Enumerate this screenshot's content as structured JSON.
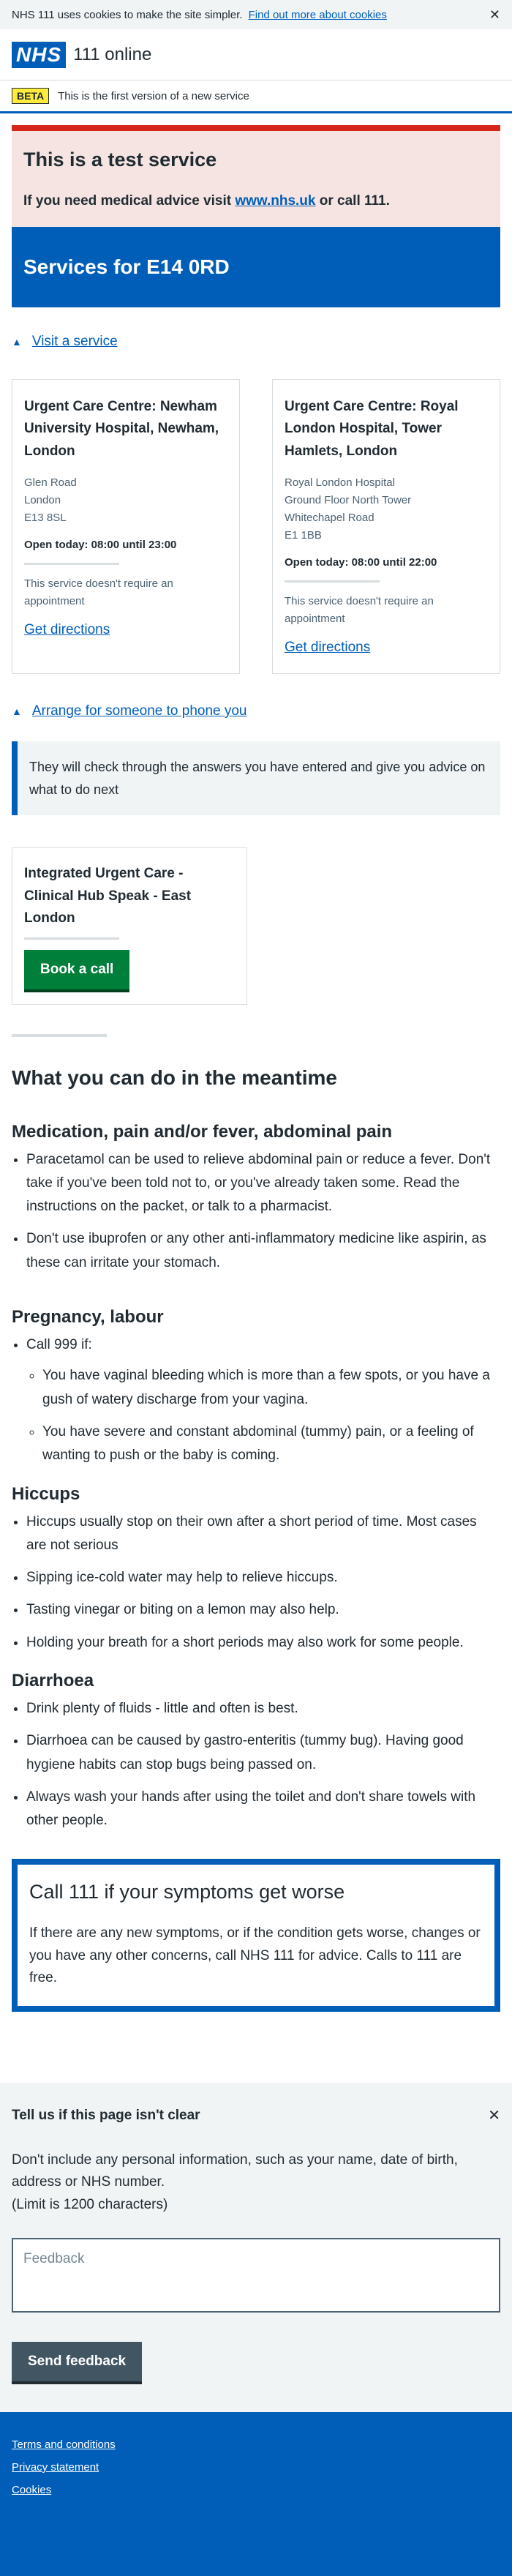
{
  "cookie": {
    "text": "NHS 111 uses cookies to make the site simpler.",
    "link": "Find out more about cookies",
    "close": "✕"
  },
  "header": {
    "logo": "NHS",
    "service": "111 online"
  },
  "beta": {
    "tag": "BETA",
    "text": "This is the first version of a new service"
  },
  "test_service": {
    "title": "This is a test service",
    "text_before": "If you need medical advice visit",
    "link": "www.nhs.uk",
    "text_after": "or call 111."
  },
  "services": {
    "title": "Services for E14 0RD"
  },
  "visit": {
    "label": "Visit a service",
    "cards": [
      {
        "name": "Urgent Care Centre: Newham University Hospital, Newham, London",
        "address": [
          "Glen Road",
          "London",
          "E13 8SL"
        ],
        "open": "Open today: 08:00 until 23:00",
        "appt": "This service doesn't require an appointment",
        "directions": "Get directions"
      },
      {
        "name": "Urgent Care Centre: Royal London Hospital, Tower Hamlets, London",
        "address": [
          "Royal London Hospital",
          "Ground Floor North Tower",
          "Whitechapel Road",
          "E1 1BB"
        ],
        "open": "Open today: 08:00 until 22:00",
        "appt": "This service doesn't require an appointment",
        "directions": "Get directions"
      }
    ]
  },
  "phone": {
    "label": "Arrange for someone to phone you",
    "inset": "They will check through the answers you have entered and give you advice on what to do next",
    "card_title": "Integrated Urgent Care - Clinical Hub Speak - East London",
    "button": "Book a call"
  },
  "meantime": {
    "title": "What you can do in the meantime",
    "sections": [
      {
        "heading": "Medication, pain and/or fever, abdominal pain",
        "items": [
          "Paracetamol can be used to relieve abdominal pain or reduce a fever. Don't take if you've been told not to, or you've already taken some. Read the instructions on the packet, or talk to a pharmacist.",
          "Don't use ibuprofen or any other anti-inflammatory medicine like aspirin, as these can irritate your stomach."
        ]
      },
      {
        "heading": "Pregnancy, labour",
        "lead": "Call 999 if:",
        "subitems": [
          "You have vaginal bleeding which is more than a few spots, or you have a gush of watery discharge from your vagina.",
          "You have severe and constant abdominal (tummy) pain, or a feeling of wanting to push or the baby is coming."
        ]
      },
      {
        "heading": "Hiccups",
        "items": [
          "Hiccups usually stop on their own after a short period of time. Most cases are not serious",
          "Sipping ice-cold water may help to relieve hiccups.",
          "Tasting vinegar or biting on a lemon may also help.",
          "Holding your breath for a short periods may also work for some people."
        ]
      },
      {
        "heading": "Diarrhoea",
        "items": [
          "Drink plenty of fluids - little and often is best.",
          "Diarrhoea can be caused by gastro-enteritis (tummy bug). Having good hygiene habits can stop bugs being passed on.",
          "Always wash your hands after using the toilet and don't share towels with other people."
        ]
      }
    ]
  },
  "callout": {
    "title": "Call 111 if your symptoms get worse",
    "text": "If there are any new symptoms, or if the condition gets worse, changes or you have any other concerns, call NHS 111 for advice. Calls to 111 are free."
  },
  "feedback": {
    "title": "Tell us if this page isn't clear",
    "close": "✕",
    "text": "Don't include any personal information, such as your name, date of birth, address or NHS number.",
    "limit": "(Limit is 1200 characters)",
    "placeholder": "Feedback",
    "button": "Send feedback"
  },
  "footer": {
    "links": [
      "Terms and conditions",
      "Privacy statement",
      "Cookies"
    ]
  }
}
